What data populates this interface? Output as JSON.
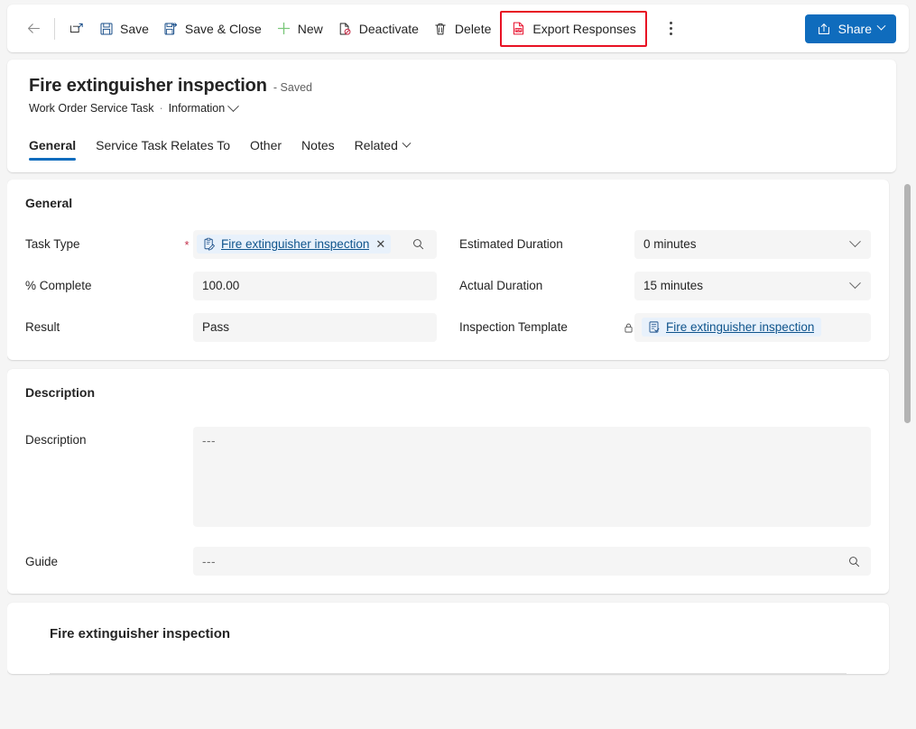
{
  "commandbar": {
    "back_label": "Back",
    "popout_label": "Open in new window",
    "save_label": "Save",
    "save_close_label": "Save & Close",
    "new_label": "New",
    "deactivate_label": "Deactivate",
    "delete_label": "Delete",
    "export_label": "Export Responses",
    "overflow_label": "More commands",
    "share_label": "Share",
    "highlight_color": "#e81123",
    "accent_color": "#0f6cbd",
    "new_icon_color": "#6bb700",
    "pdf_icon_color": "#e8112d"
  },
  "record": {
    "title": "Fire extinguisher inspection",
    "saved_status": "- Saved",
    "entity": "Work Order Service Task",
    "separator": "·",
    "form_name": "Information"
  },
  "tabs": [
    {
      "label": "General",
      "active": true
    },
    {
      "label": "Service Task Relates To",
      "active": false
    },
    {
      "label": "Other",
      "active": false
    },
    {
      "label": "Notes",
      "active": false
    },
    {
      "label": "Related",
      "active": false,
      "has_chevron": true
    }
  ],
  "general_section": {
    "title": "General",
    "left_fields": [
      {
        "label": "Task Type",
        "required": true,
        "type": "lookup",
        "value": "Fire extinguisher inspection",
        "clear_label": "✕"
      },
      {
        "label": "% Complete",
        "required": false,
        "type": "text",
        "value": "100.00"
      },
      {
        "label": "Result",
        "required": false,
        "type": "text",
        "value": "Pass"
      }
    ],
    "right_fields": [
      {
        "label": "Estimated Duration",
        "type": "dropdown",
        "value": "0 minutes"
      },
      {
        "label": "Actual Duration",
        "type": "dropdown",
        "value": "15 minutes"
      },
      {
        "label": "Inspection Template",
        "type": "lookup-locked",
        "value": "Fire extinguisher inspection"
      }
    ]
  },
  "description_section": {
    "title": "Description",
    "description_label": "Description",
    "description_value": "---",
    "guide_label": "Guide",
    "guide_value": "---"
  },
  "inspection_section": {
    "title": "Fire extinguisher inspection"
  }
}
